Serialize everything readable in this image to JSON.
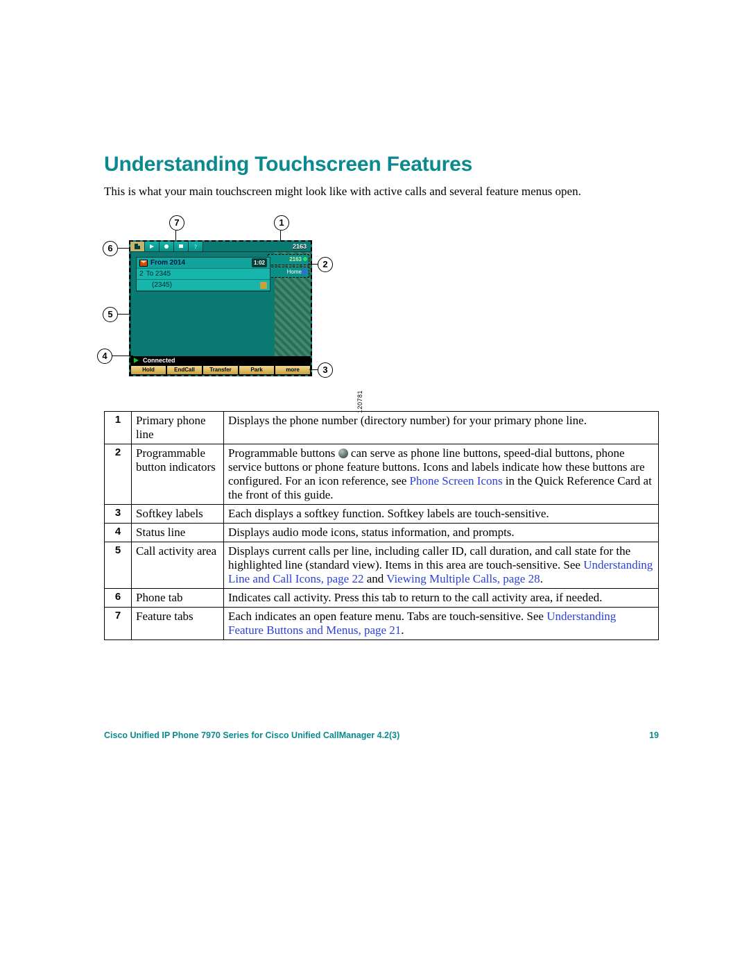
{
  "heading": "Understanding Touchscreen Features",
  "intro": "This is what your main touchscreen might look like with active calls and several feature menus open.",
  "figure_id": "120781",
  "phone": {
    "extension": "2163",
    "prog_buttons": [
      "2163",
      "Home"
    ],
    "call1_label": "From 2014",
    "call1_duration": "1:02",
    "call2_num": "2",
    "call2_label": "To 2345",
    "call2_sub": "(2345)",
    "status": "Connected",
    "softkeys": [
      "Hold",
      "EndCall",
      "Transfer",
      "Park",
      "more"
    ]
  },
  "callouts": [
    "1",
    "2",
    "3",
    "4",
    "5",
    "6",
    "7"
  ],
  "table": [
    {
      "n": "1",
      "name": "Primary phone line",
      "desc": [
        {
          "t": "text",
          "v": "Displays the phone number (directory number) for your primary phone line."
        }
      ]
    },
    {
      "n": "2",
      "name": "Programmable button indicators",
      "desc": [
        {
          "t": "text",
          "v": "Programmable buttons "
        },
        {
          "t": "icon"
        },
        {
          "t": "text",
          "v": " can serve as phone line buttons, speed-dial buttons, phone service buttons or phone feature buttons. Icons and labels indicate how these buttons are configured. For an icon reference, see "
        },
        {
          "t": "link",
          "v": "Phone Screen Icons"
        },
        {
          "t": "text",
          "v": " in the Quick Reference Card at the front of this guide."
        }
      ]
    },
    {
      "n": "3",
      "name": "Softkey labels",
      "desc": [
        {
          "t": "text",
          "v": "Each displays a softkey function. Softkey labels are touch-sensitive."
        }
      ]
    },
    {
      "n": "4",
      "name": "Status line",
      "desc": [
        {
          "t": "text",
          "v": "Displays audio mode icons, status information, and prompts."
        }
      ]
    },
    {
      "n": "5",
      "name": "Call activity area",
      "desc": [
        {
          "t": "text",
          "v": "Displays current calls per line, including caller ID, call duration, and call state for the highlighted line (standard view). Items in this area are touch-sensitive. See "
        },
        {
          "t": "link",
          "v": "Understanding Line and Call Icons, page 22"
        },
        {
          "t": "text",
          "v": " and "
        },
        {
          "t": "link",
          "v": "Viewing Multiple Calls, page 28"
        },
        {
          "t": "text",
          "v": "."
        }
      ]
    },
    {
      "n": "6",
      "name": "Phone tab",
      "desc": [
        {
          "t": "text",
          "v": "Indicates call activity. Press this tab to return to the call activity area, if needed."
        }
      ]
    },
    {
      "n": "7",
      "name": "Feature tabs",
      "desc": [
        {
          "t": "text",
          "v": "Each indicates an open feature menu. Tabs are touch-sensitive. See "
        },
        {
          "t": "link",
          "v": "Understanding Feature Buttons and Menus, page 21"
        },
        {
          "t": "text",
          "v": "."
        }
      ]
    }
  ],
  "footer": {
    "title": "Cisco Unified IP Phone 7970 Series for Cisco Unified CallManager 4.2(3)",
    "page": "19"
  }
}
